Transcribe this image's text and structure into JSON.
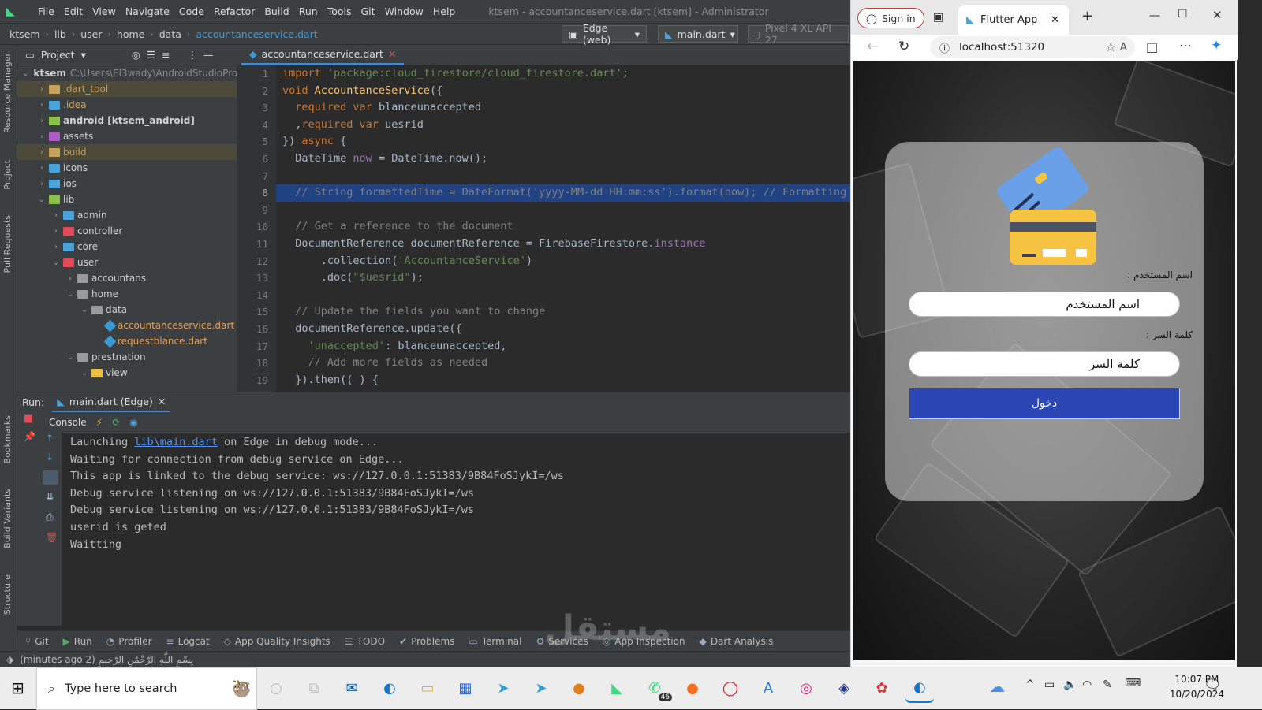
{
  "ide": {
    "menu": [
      "File",
      "Edit",
      "View",
      "Navigate",
      "Code",
      "Refactor",
      "Build",
      "Run",
      "Tools",
      "Git",
      "Window",
      "Help"
    ],
    "window_title": "ktsem - accountanceservice.dart [ktsem] - Administrator",
    "breadcrumb": [
      "ktsem",
      "lib",
      "user",
      "home",
      "data",
      "accountanceservice.dart"
    ],
    "device_combo": "Edge (web)",
    "config_combo": "main.dart",
    "emulator_combo": "Pixel 4 XL API 27",
    "left_stripe": [
      "Resource Manager",
      "Project",
      "Pull Requests",
      "Bookmarks",
      "Build Variants",
      "Structure"
    ],
    "project_header": "Project",
    "tree": [
      {
        "name": "ktsem",
        "path": "C:\\Users\\El3wady\\AndroidStudioProj",
        "indent": 0,
        "arrow": "v",
        "color": "#6a9fd4",
        "bold": true
      },
      {
        "name": ".dart_tool",
        "indent": 1,
        "arrow": ">",
        "color": "#c8a15a",
        "hl": true,
        "tcolor": "#c8a15a"
      },
      {
        "name": ".idea",
        "indent": 1,
        "arrow": ">",
        "color": "#4aa3d8",
        "tcolor": "#c8a15a"
      },
      {
        "name": "android [ktsem_android]",
        "indent": 1,
        "arrow": ">",
        "color": "#8bc34a",
        "bold": true
      },
      {
        "name": "assets",
        "indent": 1,
        "arrow": ">",
        "color": "#b05cc8"
      },
      {
        "name": "build",
        "indent": 1,
        "arrow": ">",
        "color": "#c8a15a",
        "hl": true,
        "tcolor": "#c8a15a"
      },
      {
        "name": "icons",
        "indent": 1,
        "arrow": ">",
        "color": "#4aa3d8"
      },
      {
        "name": "ios",
        "indent": 1,
        "arrow": ">",
        "color": "#4aa3d8"
      },
      {
        "name": "lib",
        "indent": 1,
        "arrow": "v",
        "color": "#8bc34a"
      },
      {
        "name": "admin",
        "indent": 2,
        "arrow": ">",
        "color": "#4aa3d8"
      },
      {
        "name": "controller",
        "indent": 2,
        "arrow": ">",
        "color": "#e04c5a"
      },
      {
        "name": "core",
        "indent": 2,
        "arrow": ">",
        "color": "#4aa3d8"
      },
      {
        "name": "user",
        "indent": 2,
        "arrow": "v",
        "color": "#e04c5a"
      },
      {
        "name": "accountans",
        "indent": 3,
        "arrow": ">",
        "color": "#9a9a9a"
      },
      {
        "name": "home",
        "indent": 3,
        "arrow": "v",
        "color": "#9a9a9a"
      },
      {
        "name": "data",
        "indent": 4,
        "arrow": "v",
        "color": "#9a9a9a"
      },
      {
        "name": "accountanceservice.dart",
        "indent": 5,
        "arrow": "",
        "color": "#3a9ad9",
        "tcolor": "#e0a15a",
        "file": true
      },
      {
        "name": "requestblance.dart",
        "indent": 5,
        "arrow": "",
        "color": "#3a9ad9",
        "tcolor": "#e0a15a",
        "file": true
      },
      {
        "name": "prestnation",
        "indent": 3,
        "arrow": "v",
        "color": "#9a9a9a"
      },
      {
        "name": "view",
        "indent": 4,
        "arrow": "v",
        "color": "#e8c240"
      }
    ],
    "editor_tab": "accountanceservice.dart",
    "code": [
      [
        [
          "kw",
          "import "
        ],
        [
          "str",
          "'package:cloud_firestore/cloud_firestore.dart'"
        ],
        [
          "pl",
          ";"
        ]
      ],
      [
        [
          "kw",
          "void "
        ],
        [
          "fn",
          "AccountanceService"
        ],
        [
          "pl",
          "({"
        ]
      ],
      [
        [
          "pl",
          "  "
        ],
        [
          "kw",
          "required var "
        ],
        [
          "pl",
          "blanceunaccepted"
        ]
      ],
      [
        [
          "pl",
          "  ,"
        ],
        [
          "kw",
          "required var "
        ],
        [
          "pl",
          "uesrid"
        ]
      ],
      [
        [
          "pl",
          "}) "
        ],
        [
          "kw",
          "async "
        ],
        [
          "pl",
          "{"
        ]
      ],
      [
        [
          "pl",
          "  "
        ],
        [
          "ty",
          "DateTime "
        ],
        [
          "cls",
          "now"
        ],
        [
          "pl",
          " = DateTime.now();"
        ]
      ],
      [
        [
          "pl",
          ""
        ]
      ],
      [
        [
          "cm",
          "  // String formattedTime = DateFormat('yyyy-MM-dd HH:mm:ss').format(now); // Formatting the"
        ]
      ],
      [
        [
          "pl",
          ""
        ]
      ],
      [
        [
          "cm",
          "  // Get a reference to the document"
        ]
      ],
      [
        [
          "pl",
          "  "
        ],
        [
          "ty",
          "DocumentReference "
        ],
        [
          "pl",
          "documentReference = "
        ],
        [
          "ty",
          "FirebaseFirestore"
        ],
        [
          "pl",
          "."
        ],
        [
          "cls",
          "instance"
        ]
      ],
      [
        [
          "pl",
          "      .collection("
        ],
        [
          "str",
          "'AccountanceService'"
        ],
        [
          "pl",
          ")"
        ]
      ],
      [
        [
          "pl",
          "      .doc("
        ],
        [
          "str",
          "\"$uesrid\""
        ],
        [
          "pl",
          ");"
        ]
      ],
      [
        [
          "pl",
          ""
        ]
      ],
      [
        [
          "cm",
          "  // Update the fields you want to change"
        ]
      ],
      [
        [
          "pl",
          "  documentReference.update({"
        ]
      ],
      [
        [
          "pl",
          "    "
        ],
        [
          "str",
          "'unaccepted'"
        ],
        [
          "pl",
          ": blanceunaccepted,"
        ]
      ],
      [
        [
          "cm",
          "    // Add more fields as needed"
        ]
      ],
      [
        [
          "pl",
          "  }).then(( ) {"
        ]
      ]
    ],
    "line_numbers": [
      "1",
      "2",
      "3",
      "4",
      "5",
      "6",
      "7",
      "8",
      "9",
      "10",
      "11",
      "12",
      "13",
      "14",
      "15",
      "16",
      "17",
      "18",
      "19"
    ],
    "run_label": "Run:",
    "run_tab": "main.dart (Edge)",
    "console_tab": "Console",
    "console": [
      {
        "pre": "Launching ",
        "link": "lib\\main.dart",
        "post": " on Edge in debug mode..."
      },
      {
        "pre": "Waiting for connection from debug service on Edge...",
        "link": "",
        "post": ""
      },
      {
        "pre": "This app is linked to the debug service: ws://127.0.0.1:51383/9B84FoSJykI=/ws",
        "link": "",
        "post": ""
      },
      {
        "pre": "Debug service listening on ws://127.0.0.1:51383/9B84FoSJykI=/ws",
        "link": "",
        "post": ""
      },
      {
        "pre": "Debug service listening on ws://127.0.0.1:51383/9B84FoSJykI=/ws",
        "link": "",
        "post": ""
      },
      {
        "pre": "userid is geted",
        "link": "",
        "post": ""
      },
      {
        "pre": "Waitting",
        "link": "",
        "post": ""
      }
    ],
    "bottom_tools": [
      "Git",
      "Run",
      "Profiler",
      "Logcat",
      "App Quality Insights",
      "TODO",
      "Problems",
      "Terminal",
      "Services",
      "App Inspection",
      "Dart Analysis"
    ],
    "status": "بِسْمِ اللَّهِ الرَّحْمَٰنِ الرَّحِيمِ (2 minutes ago)"
  },
  "browser": {
    "signin": "Sign in",
    "tab_title": "Flutter App",
    "url": "localhost:51320",
    "app": {
      "username_label": "اسم المستخدم :",
      "username_placeholder": "اسم المستخدم",
      "password_label": "كلمة السر :",
      "password_placeholder": "كلمة السر",
      "login_button": "دخول"
    }
  },
  "taskbar": {
    "search_placeholder": "Type here to search",
    "time": "10:07 PM",
    "date": "10/20/2024",
    "badge": "46"
  },
  "watermark": "مستقل"
}
